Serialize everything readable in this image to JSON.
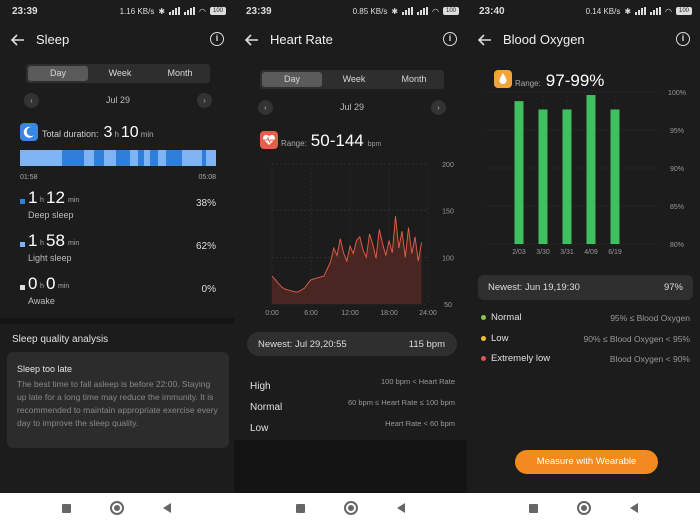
{
  "status": [
    {
      "time": "23:39",
      "net": "1.16 KB/s",
      "batt": "100"
    },
    {
      "time": "23:39",
      "net": "0.85 KB/s",
      "batt": "100"
    },
    {
      "time": "23:40",
      "net": "0.14 KB/s",
      "batt": "100"
    }
  ],
  "sleep": {
    "title": "Sleep",
    "tabs": [
      "Day",
      "Week",
      "Month"
    ],
    "date": "Jul 29",
    "total_label": "Total duration:",
    "total_h": "3",
    "total_h_unit": "h",
    "total_m": "10",
    "total_m_unit": "min",
    "start_time": "01:58",
    "end_time": "05:08",
    "stages": [
      {
        "h": "1",
        "m": "12",
        "label": "Deep sleep",
        "pct": "38%",
        "color": "#2f7fd8"
      },
      {
        "h": "1",
        "m": "58",
        "label": "Light sleep",
        "pct": "62%",
        "color": "#7fb4f4"
      },
      {
        "h": "0",
        "m": "0",
        "label": "Awake",
        "pct": "0%",
        "color": "#dcdcdc"
      }
    ],
    "quality_heading": "Sleep quality analysis",
    "quality_title": "Sleep too late",
    "quality_text": "The best time to fall asleep is before 22:00. Staying up late for a long time may reduce the immunity. It is recommended to maintain appropriate exercise every day to improve the sleep quality."
  },
  "heart": {
    "title": "Heart Rate",
    "tabs": [
      "Day",
      "Week",
      "Month"
    ],
    "date": "Jul 29",
    "range_label": "Range:",
    "range_value": "50-144",
    "range_unit": "bpm",
    "newest_label": "Newest: Jul 29,20:55",
    "newest_value": "115 bpm",
    "zones": [
      {
        "name": "High",
        "rule": "100 bpm < Heart Rate"
      },
      {
        "name": "Normal",
        "rule": "60 bpm ≤ Heart Rate ≤ 100 bpm"
      },
      {
        "name": "Low",
        "rule": "Heart Rate < 60 bpm"
      }
    ]
  },
  "oxygen": {
    "title": "Blood Oxygen",
    "range_label": "Range:",
    "range_value": "97-99%",
    "newest_label": "Newest: Jun 19,19:30",
    "newest_value": "97%",
    "legend": [
      {
        "name": "Normal",
        "rule": "95% ≤ Blood Oxygen",
        "color": "#8bc34a"
      },
      {
        "name": "Low",
        "rule": "90% ≤ Blood Oxygen < 95%",
        "color": "#f0c030"
      },
      {
        "name": "Extremely low",
        "rule": "Blood Oxygen < 90%",
        "color": "#e05555"
      }
    ],
    "button": "Measure with Wearable"
  },
  "chart_data": [
    {
      "type": "area",
      "title": "",
      "x_ticks": [
        "0:00",
        "6:00",
        "12:00",
        "18:00",
        "24:00"
      ],
      "y_ticks": [
        50,
        100,
        150,
        200
      ],
      "ylim": [
        50,
        200
      ],
      "xlim": [
        0,
        24
      ],
      "series": [
        {
          "color": "#e5604a",
          "x": [
            0.0,
            0.5,
            1.0,
            1.5,
            2.0,
            2.5,
            3.0,
            3.5,
            4.0,
            4.5,
            5.0,
            5.5,
            6.0,
            8.0,
            9.0,
            9.5,
            10.0,
            10.5,
            11.0,
            11.5,
            12.0,
            12.5,
            13.0,
            13.5,
            14.0,
            14.5,
            15.0,
            15.5,
            16.0,
            16.5,
            17.0,
            17.5,
            18.0,
            18.5,
            19.0,
            19.5,
            20.0,
            20.5,
            21.0,
            21.5,
            22.0,
            22.5,
            23.0
          ],
          "y": [
            80,
            76,
            72,
            68,
            66,
            65,
            64,
            63,
            63,
            65,
            67,
            72,
            76,
            80,
            95,
            110,
            102,
            120,
            105,
            96,
            112,
            104,
            118,
            122,
            108,
            100,
            125,
            114,
            99,
            130,
            115,
            102,
            118,
            105,
            144,
            110,
            128,
            100,
            132,
            104,
            122,
            96,
            116
          ]
        }
      ]
    },
    {
      "type": "bar",
      "title": "",
      "categories": [
        "2/03",
        "3/30",
        "3/31",
        "4/09",
        "6/19"
      ],
      "values": [
        98.8,
        97.7,
        97.7,
        99.6,
        97.7
      ],
      "y_ticks": [
        "80%",
        "85%",
        "90%",
        "95%",
        "100%"
      ],
      "ylim": [
        80,
        100
      ],
      "color": "#3fbf5f",
      "grid": true
    }
  ]
}
